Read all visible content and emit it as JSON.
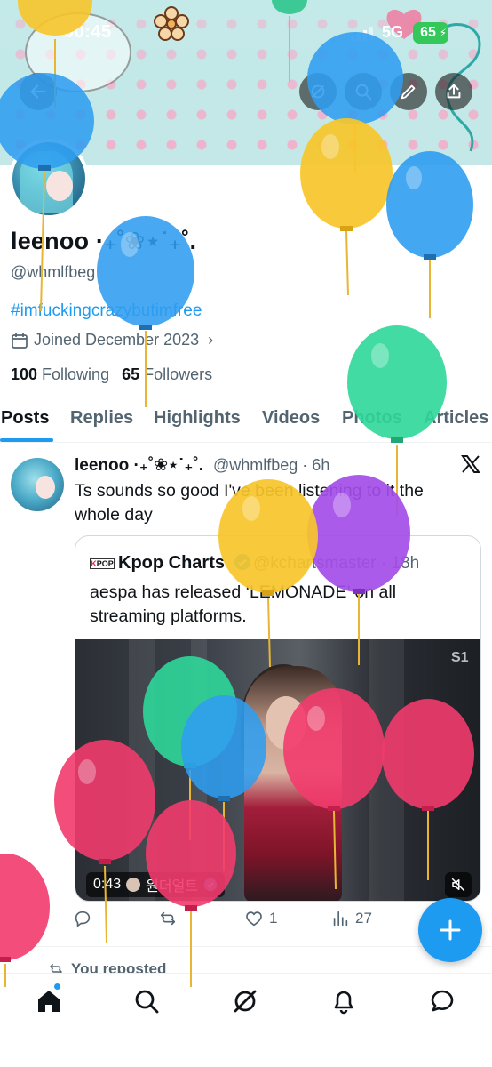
{
  "status_bar": {
    "time": "00:45",
    "network": "5G",
    "battery": "65"
  },
  "profile": {
    "display_name": "leenoo ·₊˚❀⋆˙₊˚.",
    "handle": "@whmlfbeg",
    "bio": "#imfuckingcrazybutimfree",
    "joined": "Joined December 2023",
    "following_count": "100",
    "following_label": "Following",
    "followers_count": "65",
    "followers_label": "Followers"
  },
  "tabs": [
    {
      "label": "Posts",
      "active": true
    },
    {
      "label": "Replies"
    },
    {
      "label": "Highlights"
    },
    {
      "label": "Videos"
    },
    {
      "label": "Photos"
    },
    {
      "label": "Articles"
    }
  ],
  "post": {
    "author": "leenoo ·₊˚❀⋆˙₊˚.",
    "meta": "@whmlfbeg · 6h",
    "text": "Ts sounds so good I've been listening to it the whole day",
    "quote": {
      "badge_left": "K",
      "badge_right": "POP",
      "author": "Kpop Charts",
      "meta": "@kchartsmaster · 18h",
      "text": "aespa has released ‘LEMONADE’ on all streaming platforms.",
      "media": {
        "duration": "0:43",
        "channel": "원더얼트"
      }
    },
    "actions": {
      "replies": "",
      "reposts": "",
      "likes": "1",
      "views": "27"
    }
  },
  "next_item": {
    "label": "You reposted"
  },
  "icons": {
    "header": [
      "search-icon",
      "grok-icon",
      "edit-icon",
      "share-icon"
    ],
    "nav": [
      "home-icon",
      "search-icon",
      "grok-icon",
      "notifications-icon",
      "messages-icon"
    ]
  },
  "colors": {
    "accent": "#1d9bf0",
    "text": "#0f1419",
    "secondary": "#536471",
    "battery": "#34c759"
  }
}
